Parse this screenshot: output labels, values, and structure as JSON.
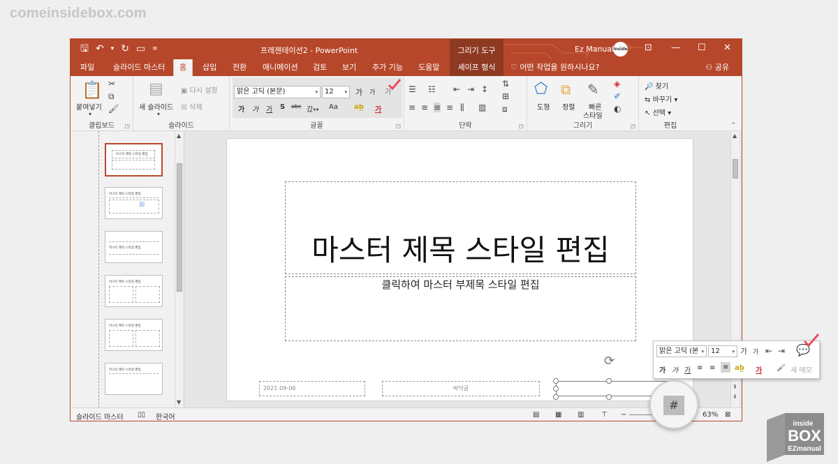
{
  "watermark": "comeinsidebox.com",
  "logo": {
    "line1": "inside",
    "line2": "BOX",
    "line3": "EZmanual"
  },
  "titlebar": {
    "title": "프레젠테이션2  -  PowerPoint",
    "context_header": "그리기 도구",
    "user": "Ez Manual",
    "avatar_text": "Inside Box",
    "qat": {
      "save": "🖫",
      "undo": "↶",
      "redo": "↻",
      "preview": "▭",
      "more": "▾"
    }
  },
  "tabs": [
    "파일",
    "슬라이드 마스터",
    "홈",
    "삽입",
    "전환",
    "애니메이션",
    "검토",
    "보기",
    "추가 기능",
    "도움말",
    "셰이프 형식"
  ],
  "active_tab": "홈",
  "tell_me": "어떤 작업을 원하시나요?",
  "share": "공유",
  "ribbon": {
    "clipboard": {
      "label": "클립보드",
      "paste": "붙여넣기"
    },
    "slides": {
      "label": "슬라이드",
      "new_slide": "새 슬라이드",
      "reset": "다시 설정",
      "delete": "삭제"
    },
    "font": {
      "label": "글꼴",
      "font_name": "맑은 고딕 (본문)",
      "font_size": "12",
      "grow": "가",
      "shrink": "가",
      "clear": "가",
      "bold": "가",
      "italic": "가",
      "underline": "가",
      "shadow": "S",
      "strike": "abc",
      "spacing": "갔↔",
      "case": "Aa"
    },
    "paragraph": {
      "label": "단락"
    },
    "drawing": {
      "label": "그리기",
      "shapes": "도형",
      "arrange": "정렬",
      "quick_styles": "빠른",
      "quick_styles2": "스타일"
    },
    "editing": {
      "label": "편집",
      "find": "찾기",
      "replace": "바꾸기",
      "select": "선택"
    }
  },
  "slide": {
    "title": "마스터 제목 스타일 편집",
    "subtitle": "클릭하여 마스터 부제목 스타일 편집",
    "date": "2021-09-06",
    "footer": "바닥글"
  },
  "thumbnails": [
    {
      "title": "마스터 제목 스타일 편집"
    },
    {
      "title": "마스터 제목 스타일 편집"
    },
    {
      "title": "마스터 제목 스타일 편집"
    },
    {
      "title": "마스터 제목 스타일 편집"
    },
    {
      "title": "마스터 제목 스타일 편집"
    },
    {
      "title": "마스터 제목 스타일 편집"
    }
  ],
  "statusbar": {
    "view": "슬라이드 마스터",
    "language": "한국어",
    "zoom": "63%"
  },
  "mini_toolbar": {
    "font_name": "맑은 고딕 (본",
    "font_size": "12",
    "new_comment": "새 메모",
    "bold": "가",
    "italic": "가",
    "underline": "가"
  },
  "colors": {
    "accent": "#b7472a",
    "context": "#8e3a22",
    "check": "#e8505b"
  }
}
